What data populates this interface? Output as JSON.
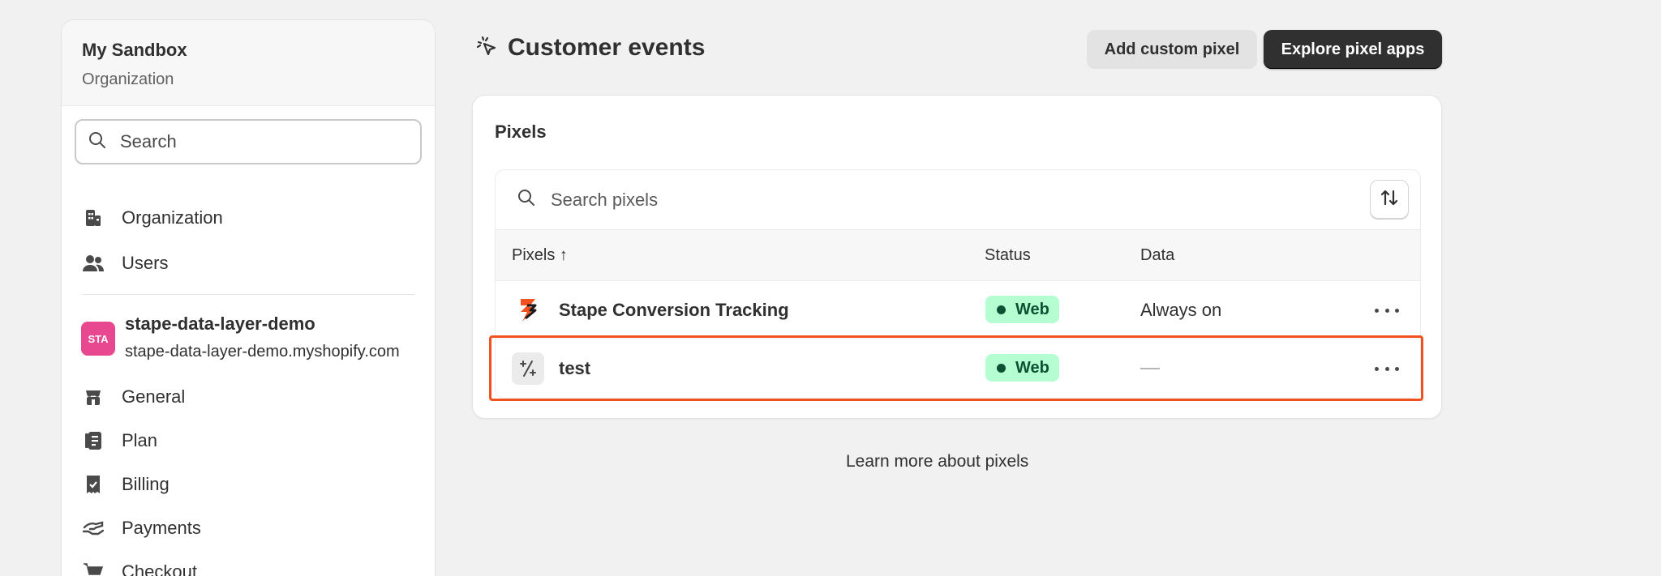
{
  "sidebar": {
    "org_name": "My Sandbox",
    "org_sub": "Organization",
    "search_placeholder": "Search",
    "top_items": [
      {
        "label": "Organization",
        "icon": "building-icon"
      },
      {
        "label": "Users",
        "icon": "users-icon"
      }
    ],
    "store": {
      "avatar": "STA",
      "name": "stape-data-layer-demo",
      "domain": "stape-data-layer-demo.myshopify.com",
      "avatar_color": "#e8488f"
    },
    "store_items": [
      {
        "label": "General",
        "icon": "store-icon"
      },
      {
        "label": "Plan",
        "icon": "plan-icon"
      },
      {
        "label": "Billing",
        "icon": "billing-icon"
      },
      {
        "label": "Payments",
        "icon": "payments-icon"
      },
      {
        "label": "Checkout",
        "icon": "cart-icon"
      }
    ]
  },
  "header": {
    "title": "Customer events",
    "add_custom_pixel": "Add custom pixel",
    "explore_pixel_apps": "Explore pixel apps"
  },
  "card": {
    "title": "Pixels",
    "search_placeholder": "Search pixels",
    "columns": {
      "name": "Pixels ↑",
      "status": "Status",
      "data": "Data"
    },
    "rows": [
      {
        "name": "Stape Conversion Tracking",
        "status": "Web",
        "data": "Always on",
        "icon": "stape-logo-icon"
      },
      {
        "name": "test",
        "status": "Web",
        "data": "",
        "icon": "custom-pixel-icon"
      }
    ]
  },
  "footer": {
    "learn_more": "Learn more about pixels"
  },
  "colors": {
    "accent_highlight": "#f0511e",
    "badge_bg": "#b4fed2",
    "badge_text": "#0c5132",
    "primary_button": "#303030"
  }
}
